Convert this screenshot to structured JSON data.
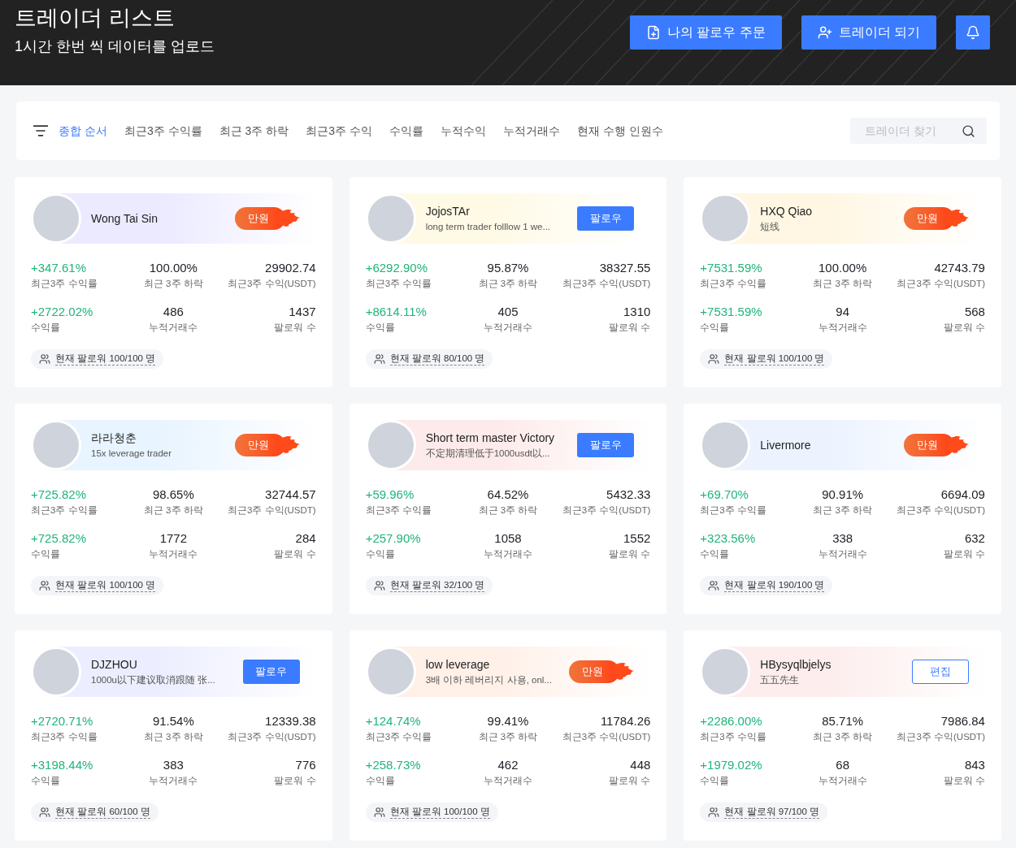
{
  "header": {
    "title": "트레이더 리스트",
    "subtitle": "1시간 한번 씩 데이터를 업로드",
    "buttons": [
      {
        "kind": "orders",
        "label": "나의 팔로우 주문"
      },
      {
        "kind": "become",
        "label": "트레이더 되기"
      }
    ]
  },
  "filter": {
    "tabs": [
      {
        "label": "종합 순서",
        "selected": true
      },
      {
        "label": "최근3주 수익률",
        "selected": false
      },
      {
        "label": "최근 3주 하락",
        "selected": false
      },
      {
        "label": "최근3주 수익",
        "selected": false
      },
      {
        "label": "수익률",
        "selected": false
      },
      {
        "label": "누적수익",
        "selected": false
      },
      {
        "label": "누적거래수",
        "selected": false
      },
      {
        "label": "현재 수행 인원수",
        "selected": false
      }
    ],
    "search": {
      "placeholder": "트레이더 찾기"
    }
  },
  "cards": [
    {
      "name": "Wong Tai Sin",
      "color": "#ebeaff",
      "action": {
        "kind": "full",
        "label": "만원"
      },
      "stats": [
        {
          "value": "+347.61%",
          "label": "최근3주 수익률",
          "kind": "gain"
        },
        {
          "value": "100.00%",
          "label": "최근 3주 하락",
          "kind": "plain"
        },
        {
          "value": "29902.74",
          "label": "최근3주 수익(USDT)",
          "kind": "plain"
        },
        {
          "value": "+2722.02%",
          "label": "수익률",
          "kind": "gain"
        },
        {
          "value": "486",
          "label": "누적거래수",
          "kind": "plain"
        },
        {
          "value": "1437",
          "label": "팔로워 수",
          "kind": "plain"
        }
      ],
      "followers": "현재 팔로워 100/100 명"
    },
    {
      "name": "JojosTAr",
      "subtitle": "long term trader folllow 1 we...",
      "color": "#fffae6",
      "action": {
        "kind": "follow",
        "label": "팔로우"
      },
      "stats": [
        {
          "value": "+6292.90%",
          "label": "최근3주 수익률",
          "kind": "gain"
        },
        {
          "value": "95.87%",
          "label": "최근 3주 하락",
          "kind": "plain"
        },
        {
          "value": "38327.55",
          "label": "최근3주 수익(USDT)",
          "kind": "plain"
        },
        {
          "value": "+8614.11%",
          "label": "수익률",
          "kind": "gain"
        },
        {
          "value": "405",
          "label": "누적거래수",
          "kind": "plain"
        },
        {
          "value": "1310",
          "label": "팔로워 수",
          "kind": "plain"
        }
      ],
      "followers": "현재 팔로워 80/100 명"
    },
    {
      "name": "HXQ Qiao",
      "subtitle": "短线",
      "color": "#fff7e3",
      "action": {
        "kind": "full",
        "label": "만원"
      },
      "stats": [
        {
          "value": "+7531.59%",
          "label": "최근3주 수익률",
          "kind": "gain"
        },
        {
          "value": "100.00%",
          "label": "최근 3주 하락",
          "kind": "plain"
        },
        {
          "value": "42743.79",
          "label": "최근3주 수익(USDT)",
          "kind": "plain"
        },
        {
          "value": "+7531.59%",
          "label": "수익률",
          "kind": "gain"
        },
        {
          "value": "94",
          "label": "누적거래수",
          "kind": "plain"
        },
        {
          "value": "568",
          "label": "팔로워 수",
          "kind": "plain"
        }
      ],
      "followers": "현재 팔로워 100/100 명"
    },
    {
      "name": "라라청춘",
      "subtitle": "15x leverage trader",
      "color": "#e8f4ff",
      "action": {
        "kind": "full",
        "label": "만원"
      },
      "stats": [
        {
          "value": "+725.82%",
          "label": "최근3주 수익률",
          "kind": "gain"
        },
        {
          "value": "98.65%",
          "label": "최근 3주 하락",
          "kind": "plain"
        },
        {
          "value": "32744.57",
          "label": "최근3주 수익(USDT)",
          "kind": "plain"
        },
        {
          "value": "+725.82%",
          "label": "수익률",
          "kind": "gain"
        },
        {
          "value": "1772",
          "label": "누적거래수",
          "kind": "plain"
        },
        {
          "value": "284",
          "label": "팔로워 수",
          "kind": "plain"
        }
      ],
      "followers": "현재 팔로워 100/100 명"
    },
    {
      "name": "Short term master Victory",
      "subtitle": "不定期清理低于1000usdt以...",
      "color": "#fdeaea",
      "action": {
        "kind": "follow",
        "label": "팔로우"
      },
      "stats": [
        {
          "value": "+59.96%",
          "label": "최근3주 수익률",
          "kind": "gain"
        },
        {
          "value": "64.52%",
          "label": "최근 3주 하락",
          "kind": "plain"
        },
        {
          "value": "5432.33",
          "label": "최근3주 수익(USDT)",
          "kind": "plain"
        },
        {
          "value": "+257.90%",
          "label": "수익률",
          "kind": "gain"
        },
        {
          "value": "1058",
          "label": "누적거래수",
          "kind": "plain"
        },
        {
          "value": "1552",
          "label": "팔로워 수",
          "kind": "plain"
        }
      ],
      "followers": "현재 팔로워 32/100 명"
    },
    {
      "name": "Livermore",
      "color": "#ecf3ff",
      "action": {
        "kind": "full",
        "label": "만원"
      },
      "stats": [
        {
          "value": "+69.70%",
          "label": "최근3주 수익률",
          "kind": "gain"
        },
        {
          "value": "90.91%",
          "label": "최근 3주 하락",
          "kind": "plain"
        },
        {
          "value": "6694.09",
          "label": "최근3주 수익(USDT)",
          "kind": "plain"
        },
        {
          "value": "+323.56%",
          "label": "수익률",
          "kind": "gain"
        },
        {
          "value": "338",
          "label": "누적거래수",
          "kind": "plain"
        },
        {
          "value": "632",
          "label": "팔로워 수",
          "kind": "plain"
        }
      ],
      "followers": "현재 팔로워 190/100 명"
    },
    {
      "name": "DJZHOU",
      "subtitle": "1000u以下建议取消跟随 张...",
      "color": "#eceeff",
      "action": {
        "kind": "follow",
        "label": "팔로우"
      },
      "stats": [
        {
          "value": "+2720.71%",
          "label": "최근3주 수익률",
          "kind": "gain"
        },
        {
          "value": "91.54%",
          "label": "최근 3주 하락",
          "kind": "plain"
        },
        {
          "value": "12339.38",
          "label": "최근3주 수익(USDT)",
          "kind": "plain"
        },
        {
          "value": "+3198.44%",
          "label": "수익률",
          "kind": "gain"
        },
        {
          "value": "383",
          "label": "누적거래수",
          "kind": "plain"
        },
        {
          "value": "776",
          "label": "팔로워 수",
          "kind": "plain"
        }
      ],
      "followers": "현재 팔로워 60/100 명"
    },
    {
      "name": "low leverage",
      "subtitle": "3배 이하 레버리지 사용, onl...",
      "color": "#fff0e8",
      "action": {
        "kind": "full",
        "label": "만원"
      },
      "stats": [
        {
          "value": "+124.74%",
          "label": "최근3주 수익률",
          "kind": "gain"
        },
        {
          "value": "99.41%",
          "label": "최근 3주 하락",
          "kind": "plain"
        },
        {
          "value": "11784.26",
          "label": "최근3주 수익(USDT)",
          "kind": "plain"
        },
        {
          "value": "+258.73%",
          "label": "수익률",
          "kind": "gain"
        },
        {
          "value": "462",
          "label": "누적거래수",
          "kind": "plain"
        },
        {
          "value": "448",
          "label": "팔로워 수",
          "kind": "plain"
        }
      ],
      "followers": "현재 팔로워 100/100 명"
    },
    {
      "name": "HBysyqlbjelys",
      "subtitle": "五五先生",
      "color": "#fdeded",
      "action": {
        "kind": "edit",
        "label": "편집"
      },
      "stats": [
        {
          "value": "+2286.00%",
          "label": "최근3주 수익률",
          "kind": "gain"
        },
        {
          "value": "85.71%",
          "label": "최근 3주 하락",
          "kind": "plain"
        },
        {
          "value": "7986.84",
          "label": "최근3주 수익(USDT)",
          "kind": "plain"
        },
        {
          "value": "+1979.02%",
          "label": "수익률",
          "kind": "gain"
        },
        {
          "value": "68",
          "label": "누적거래수",
          "kind": "plain"
        },
        {
          "value": "843",
          "label": "팔로워 수",
          "kind": "plain"
        }
      ],
      "followers": "현재 팔로워 97/100 명"
    }
  ]
}
